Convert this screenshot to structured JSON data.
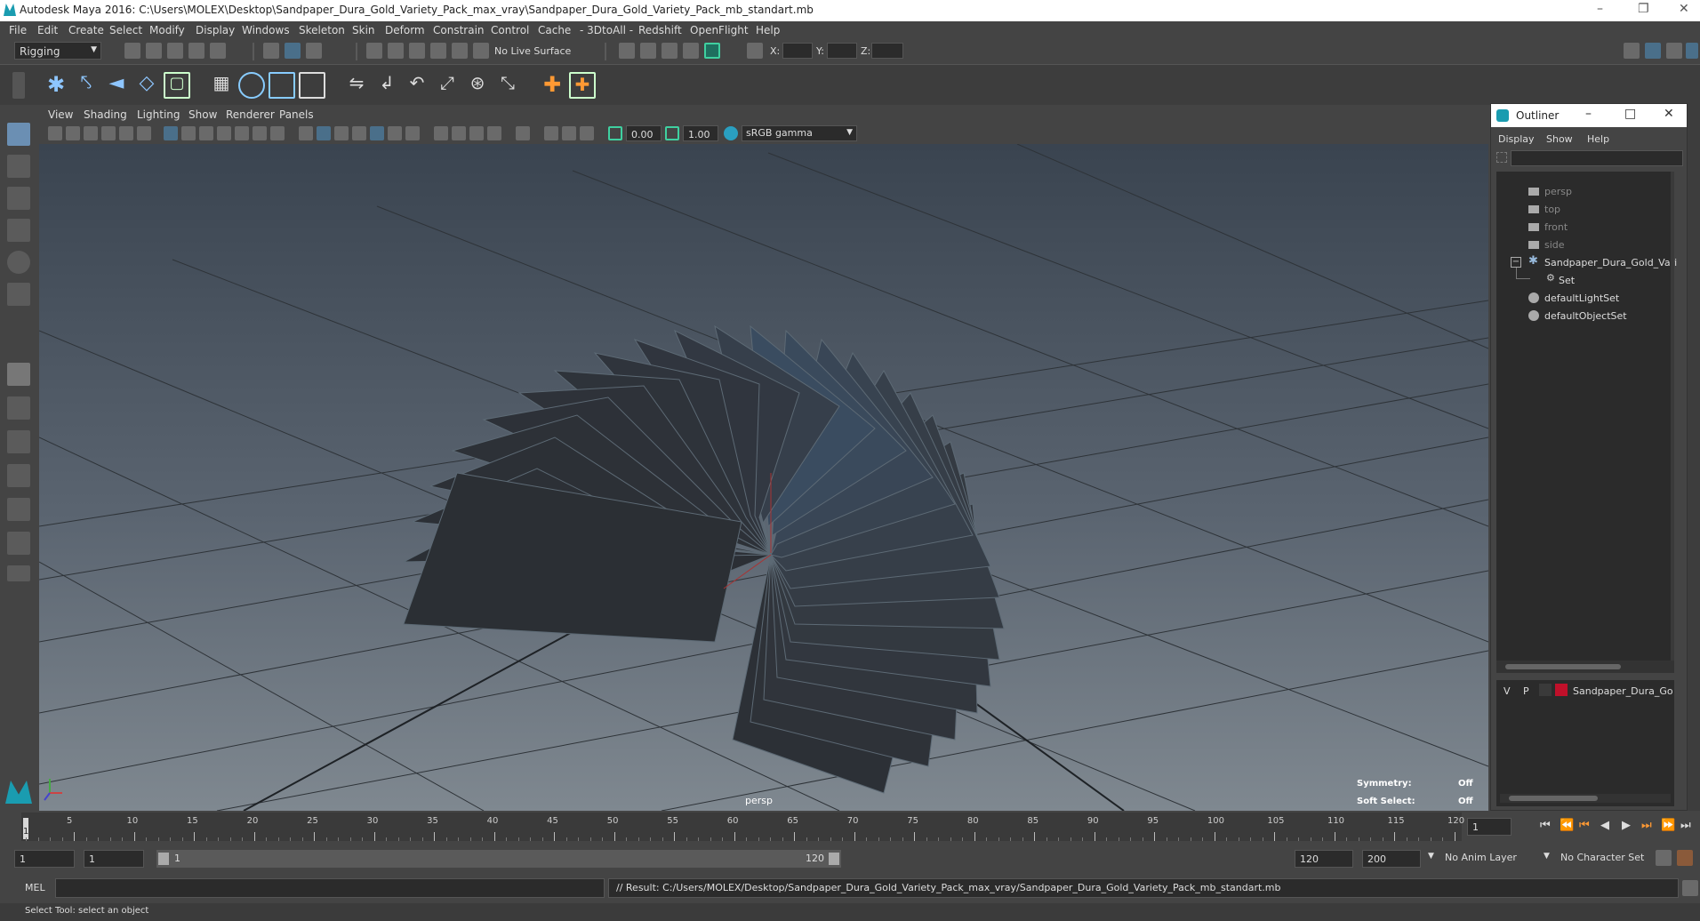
{
  "window": {
    "title": "Autodesk Maya 2016: C:\\Users\\MOLEX\\Desktop\\Sandpaper_Dura_Gold_Variety_Pack_max_vray\\Sandpaper_Dura_Gold_Variety_Pack_mb_standart.mb"
  },
  "menu": [
    "File",
    "Edit",
    "Create",
    "Select",
    "Modify",
    "Display",
    "Windows",
    "Skeleton",
    "Skin",
    "Deform",
    "Constrain",
    "Control",
    "Cache",
    "- 3DtoAll -",
    "Redshift",
    "OpenFlight",
    "Help"
  ],
  "status": {
    "mode": "Rigging",
    "live_surface": "No Live Surface",
    "x_label": "X:",
    "y_label": "Y:",
    "z_label": "Z:"
  },
  "panel_menu": [
    "View",
    "Shading",
    "Lighting",
    "Show",
    "Renderer",
    "Panels"
  ],
  "panel_toolbar": {
    "exposure": "0.00",
    "gamma": "1.00",
    "colorspace": "sRGB gamma"
  },
  "viewport": {
    "camera": "persp",
    "symmetry_label": "Symmetry:",
    "symmetry_value": "Off",
    "softsel_label": "Soft Select:",
    "softsel_value": "Off"
  },
  "outliner": {
    "title": "Outliner",
    "menu": [
      "Display",
      "Show",
      "Help"
    ],
    "items": [
      "persp",
      "top",
      "front",
      "side",
      "Sandpaper_Dura_Gold_Vari",
      "Set",
      "defaultLightSet",
      "defaultObjectSet"
    ]
  },
  "layer": {
    "v": "V",
    "p": "P",
    "name": "Sandpaper_Dura_Gold",
    "color": "#c0102a"
  },
  "timeline": {
    "ticks": [
      "5",
      "10",
      "15",
      "20",
      "25",
      "30",
      "35",
      "40",
      "45",
      "50",
      "55",
      "60",
      "65",
      "70",
      "75",
      "80",
      "85",
      "90",
      "95",
      "100",
      "105",
      "110",
      "115",
      "120"
    ],
    "start_mark": "1",
    "current_frame": "1"
  },
  "range": {
    "start": "1",
    "anim_start": "1",
    "range_start": "1",
    "range_end": "120",
    "anim_end": "120",
    "end": "200",
    "anim_layer": "No Anim Layer",
    "char_set": "No Character Set"
  },
  "cmd": {
    "lang": "MEL",
    "result": "// Result: C:/Users/MOLEX/Desktop/Sandpaper_Dura_Gold_Variety_Pack_max_vray/Sandpaper_Dura_Gold_Variety_Pack_mb_standart.mb"
  },
  "help": "Select Tool: select an object"
}
